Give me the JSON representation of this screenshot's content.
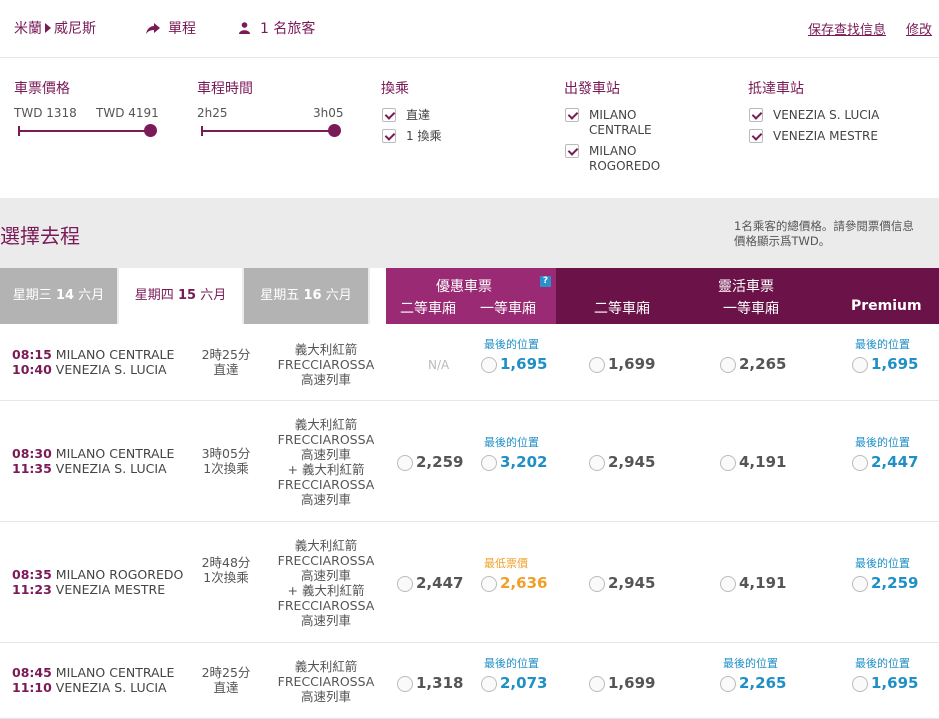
{
  "header": {
    "origin": "米蘭",
    "destination": "威尼斯",
    "trip_type": "單程",
    "passengers": "1 名旅客",
    "save_search": "保存查找信息",
    "edit": "修改"
  },
  "filters": {
    "price": {
      "title": "車票價格",
      "min": "TWD 1318",
      "max": "TWD 4191"
    },
    "time": {
      "title": "車程時間",
      "min": "2h25",
      "max": "3h05"
    },
    "transfer": {
      "title": "換乘",
      "options": [
        "直達",
        "1 換乘"
      ]
    },
    "departure": {
      "title": "出發車站",
      "options": [
        "MILANO CENTRALE",
        "MILANO ROGOREDO"
      ]
    },
    "arrival": {
      "title": "抵達車站",
      "options": [
        "VENEZIA S. LUCIA",
        "VENEZIA MESTRE"
      ]
    }
  },
  "select": {
    "title": "選擇去程",
    "note_line1": "1名乘客的總價格。請參閱票價信息",
    "note_line2": "價格顯示爲TWD。"
  },
  "date_tabs": [
    {
      "day": "星期三",
      "date": "14",
      "month": "六月",
      "active": false
    },
    {
      "day": "星期四",
      "date": "15",
      "month": "六月",
      "active": true
    },
    {
      "day": "星期五",
      "date": "16",
      "month": "六月",
      "active": false
    }
  ],
  "fare_headers": {
    "economy": {
      "title": "優惠車票",
      "cols": [
        "二等車廂",
        "一等車廂"
      ],
      "help": "?"
    },
    "flex": {
      "title": "靈活車票",
      "cols": [
        "二等車廂",
        "一等車廂",
        "Premium"
      ]
    }
  },
  "trains": [
    {
      "dep_time": "08:15",
      "dep_station": "MILANO CENTRALE",
      "arr_time": "10:40",
      "arr_station": "VENEZIA S. LUCIA",
      "duration": "2時25分",
      "changes": "直達",
      "train_lines": [
        "義大利紅箭",
        "FRECCIAROSSA",
        "高速列車"
      ],
      "fares": [
        {
          "price": "N/A",
          "tag": "",
          "style": "na"
        },
        {
          "price": "1,695",
          "tag": "最後的位置",
          "style": "blue"
        },
        {
          "price": "1,699",
          "tag": "",
          "style": "plain"
        },
        {
          "price": "2,265",
          "tag": "",
          "style": "plain"
        },
        {
          "price": "1,695",
          "tag": "最後的位置",
          "style": "blue"
        }
      ]
    },
    {
      "dep_time": "08:30",
      "dep_station": "MILANO CENTRALE",
      "arr_time": "11:35",
      "arr_station": "VENEZIA S. LUCIA",
      "duration": "3時05分",
      "changes": "1次換乘",
      "train_lines": [
        "義大利紅箭",
        "FRECCIAROSSA",
        "高速列車",
        "+ 義大利紅箭",
        "FRECCIAROSSA",
        "高速列車"
      ],
      "fares": [
        {
          "price": "2,259",
          "tag": "",
          "style": "plain"
        },
        {
          "price": "3,202",
          "tag": "最後的位置",
          "style": "blue"
        },
        {
          "price": "2,945",
          "tag": "",
          "style": "plain"
        },
        {
          "price": "4,191",
          "tag": "",
          "style": "plain"
        },
        {
          "price": "2,447",
          "tag": "最後的位置",
          "style": "blue"
        }
      ]
    },
    {
      "dep_time": "08:35",
      "dep_station": "MILANO ROGOREDO",
      "arr_time": "11:23",
      "arr_station": "VENEZIA MESTRE",
      "duration": "2時48分",
      "changes": "1次換乘",
      "train_lines": [
        "義大利紅箭",
        "FRECCIAROSSA",
        "高速列車",
        "+ 義大利紅箭",
        "FRECCIAROSSA",
        "高速列車"
      ],
      "fares": [
        {
          "price": "2,447",
          "tag": "",
          "style": "plain"
        },
        {
          "price": "2,636",
          "tag": "最低票價",
          "style": "orange"
        },
        {
          "price": "2,945",
          "tag": "",
          "style": "plain"
        },
        {
          "price": "4,191",
          "tag": "",
          "style": "plain"
        },
        {
          "price": "2,259",
          "tag": "最後的位置",
          "style": "blue"
        }
      ]
    },
    {
      "dep_time": "08:45",
      "dep_station": "MILANO CENTRALE",
      "arr_time": "11:10",
      "arr_station": "VENEZIA S. LUCIA",
      "duration": "2時25分",
      "changes": "直達",
      "train_lines": [
        "義大利紅箭",
        "FRECCIAROSSA",
        "高速列車"
      ],
      "fares": [
        {
          "price": "1,318",
          "tag": "",
          "style": "plain"
        },
        {
          "price": "2,073",
          "tag": "最後的位置",
          "style": "blue"
        },
        {
          "price": "1,699",
          "tag": "",
          "style": "plain"
        },
        {
          "price": "2,265",
          "tag": "最後的位置",
          "style": "blue"
        },
        {
          "price": "1,695",
          "tag": "最後的位置",
          "style": "blue"
        }
      ]
    }
  ],
  "colors": {
    "brand": "#7a1a57",
    "economy_header": "#9b2a74",
    "flex_header": "#6b1249",
    "tag_blue": "#1f8fc6",
    "tag_orange": "#f0a028"
  },
  "icons": [
    "arrow-right-icon",
    "share-arrow-icon",
    "person-icon",
    "checkbox-checked-icon",
    "radio-icon",
    "help-icon"
  ]
}
